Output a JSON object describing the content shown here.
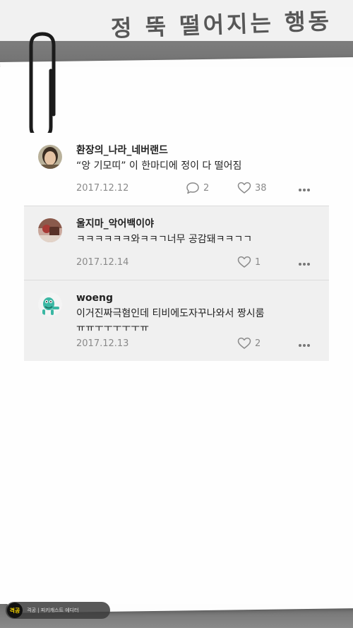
{
  "header": {
    "title": "정 뚝 떨어지는 행동"
  },
  "comments": [
    {
      "username": "환장의_나라_네버랜드",
      "text": "“앙 기모띠” 이 한마디에 정이 다 떨어짐",
      "date": "2017.12.12",
      "reply_count": "2",
      "like_count": "38"
    },
    {
      "username": "울지마_악어백이야",
      "text": "ㅋㅋㅋㅋㅋㅋ와ㅋㅋㄱ너무 공감돼ㅋㅋㄱㄱ",
      "date": "2017.12.14",
      "like_count": "1"
    },
    {
      "username": "woeng",
      "text_line1": "이거진짜극혐인데 티비에도자꾸나와서 짱시룸",
      "text_line2": "ㅠㅠㅜㅜㅜㅜㅜㅠ",
      "date": "2017.12.13",
      "like_count": "2"
    }
  ],
  "footer": {
    "logo": "격공",
    "label": "격공 | 피키캐스트 에디터"
  },
  "icons": {
    "reply": "speech-bubble-icon",
    "like": "heart-icon",
    "more": "more-dots-icon"
  }
}
